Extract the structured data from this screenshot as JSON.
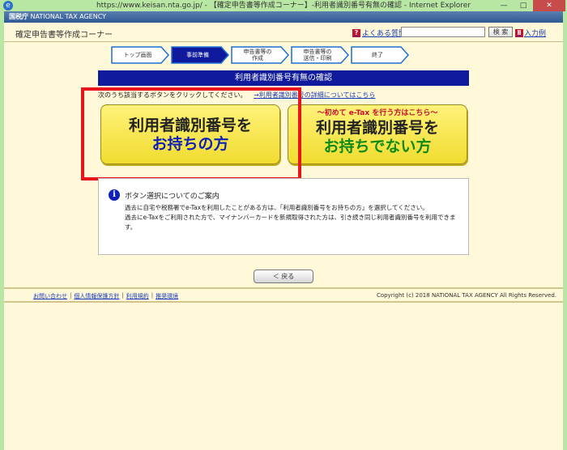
{
  "window": {
    "title": "https://www.keisan.nta.go.jp/ - 【確定申告書等作成コーナー】-利用者識別番号有無の確認 - Internet Explorer",
    "minimize": "—",
    "maximize": "□",
    "close": "✕"
  },
  "agency": {
    "kanji": "国税庁",
    "name": "NATIONAL TAX AGENCY"
  },
  "header": {
    "site_title": "確定申告書等作成コーナー",
    "faq_label": "よくある質問",
    "search_value": "",
    "search_button": "検 索",
    "example_label": "入力例"
  },
  "steps": [
    {
      "label": "トップ画面"
    },
    {
      "label": "事前準備"
    },
    {
      "label": "申告書等の\n作成"
    },
    {
      "label": "申告書等の\n送信・印刷"
    },
    {
      "label": "終了"
    }
  ],
  "banner": "利用者識別番号有無の確認",
  "instruction": {
    "text": "次のうち該当するボタンをクリックしてください。",
    "link": "→利用者識別番号の詳細についてはこちら"
  },
  "choices": {
    "have": {
      "line1": "利用者識別番号を",
      "line2": "お持ちの方"
    },
    "not_have": {
      "sub": "～初めて e-Tax を行う方はこちら～",
      "line1": "利用者識別番号を",
      "line2": "お持ちでない方"
    }
  },
  "info": {
    "icon": "i",
    "title": "ボタン選択についてのご案内",
    "para1": "過去に自宅や税務署でe-Taxを利用したことがある方は、「利用者識別番号をお持ちの方」を選択してください。",
    "para2": "過去にe-Taxをご利用された方で、マイナンバーカードを新規取得された方は、引き続き同じ利用者識別番号を利用できます。"
  },
  "back_button": "＜ 戻る",
  "footer": {
    "links": [
      "お問い合わせ",
      "個人情報保護方針",
      "利用規約",
      "推奨環境"
    ],
    "copyright": "Copyright (c) 2018 NATIONAL TAX AGENCY All Rights Reserved."
  },
  "colors": {
    "banner_bg": "#0f1a9c",
    "button_yellow": "#f1dc2f",
    "highlight_red": "#e8161c",
    "step_active": "#0f1a9c"
  }
}
